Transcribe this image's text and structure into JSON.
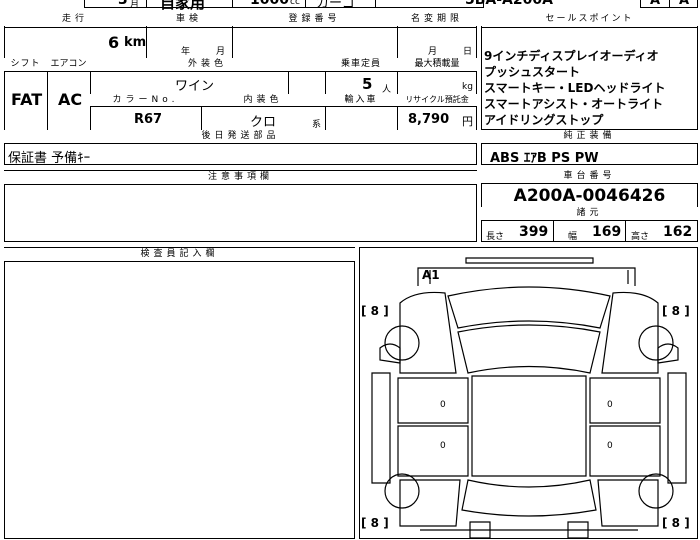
{
  "top": {
    "month_suffix": "月",
    "year_label": "3",
    "usage": "自家用",
    "displacement": "1000",
    "displacement_unit": "cc",
    "body_type": "カーゴ",
    "model_code": "5BA-A200A",
    "badge1": "A",
    "badge2": "A"
  },
  "headers": {
    "mileage": "走行",
    "inspection": "車検",
    "registration": "登録番号",
    "title_change": "名変期限",
    "sale_points": "セールスポイント",
    "shift": "シフト",
    "aircon": "エアコン",
    "exterior_color": "外装色",
    "capacity": "乗車定員",
    "max_load": "最大積載量",
    "color_no": "カラーNo.",
    "interior_color": "内装色",
    "import": "輸入車",
    "recycle": "リサイクル預託金",
    "later_parts": "後日発送部品",
    "equipment": "純正装備",
    "notes": "注意事項欄",
    "chassis_no": "車台番号",
    "dimensions": "諸元",
    "inspector": "検査員記入欄"
  },
  "values": {
    "mileage": "6",
    "mileage_unit": "km",
    "inspection_year": "年",
    "inspection_month": "月",
    "title_month": "月",
    "title_day": "日",
    "shift": "FAT",
    "aircon": "AC",
    "exterior_color": "ワイン",
    "capacity": "5",
    "capacity_unit": "人",
    "load_unit": "kg",
    "color_no": "R67",
    "interior_color": "クロ",
    "interior_suffix": "系",
    "recycle": "8,790",
    "recycle_unit": "円",
    "later_parts": "保証書 予備ｷｰ",
    "equipment": "ABS ｴｱB PS PW",
    "chassis_no": "A200A-0046426",
    "length_label": "長さ",
    "length": "399",
    "width_label": "幅",
    "width": "169",
    "height_label": "高さ",
    "height": "162"
  },
  "sale_points": [
    "9インチディスプレイオーディオ",
    "プッシュスタート",
    "スマートキー・LEDヘッドライト",
    "スマートアシスト・オートライト",
    "アイドリングストップ"
  ],
  "diagram": {
    "mark": "A1",
    "tire_fl": "[ 8 ]",
    "tire_fr": "[ 8 ]",
    "tire_rl": "[ 8 ]",
    "tire_rr": "[ 8 ]",
    "door_left": "0",
    "door_right": "0",
    "rear_left": "0",
    "rear_right": "0"
  }
}
